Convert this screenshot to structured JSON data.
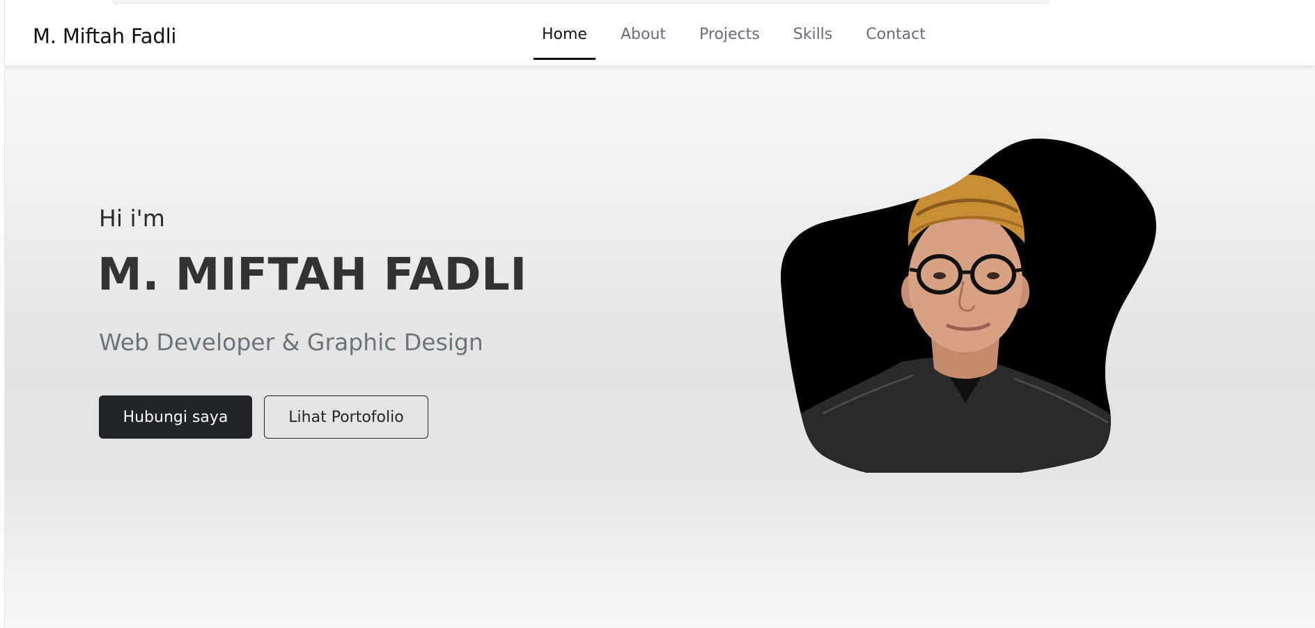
{
  "navbar": {
    "brand": "M. Miftah Fadli",
    "items": [
      {
        "label": "Home",
        "active": true
      },
      {
        "label": "About",
        "active": false
      },
      {
        "label": "Projects",
        "active": false
      },
      {
        "label": "Skills",
        "active": false
      },
      {
        "label": "Contact",
        "active": false
      }
    ]
  },
  "hero": {
    "greeting": "Hi i'm",
    "name": "M. MIFTAH FADLI",
    "subtitle": "Web Developer & Graphic Design",
    "primary_button": "Hubungi saya",
    "secondary_button": "Lihat Portofolio"
  },
  "colors": {
    "text_dark": "#333333",
    "subtitle": "#6b737b",
    "button_dark": "#212529",
    "nav_inactive": "#6b6b7b"
  }
}
